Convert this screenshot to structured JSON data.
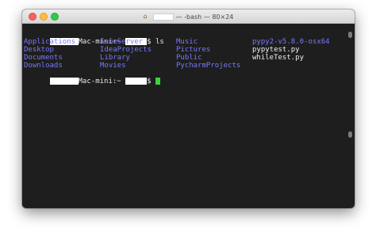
{
  "window": {
    "title_suffix": "— -bash — 80×24"
  },
  "prompt1": {
    "host_suffix": "Mac-mini:~",
    "user_suffix": "$",
    "command": "ls"
  },
  "listing": {
    "rows": [
      [
        {
          "name": "Applications",
          "kind": "dir"
        },
        {
          "name": "GameServer",
          "kind": "dir"
        },
        {
          "name": "Music",
          "kind": "dir"
        },
        {
          "name": "pypy2-v5.8.0-osx64",
          "kind": "dir"
        }
      ],
      [
        {
          "name": "Desktop",
          "kind": "dir"
        },
        {
          "name": "IdeaProjects",
          "kind": "dir"
        },
        {
          "name": "Pictures",
          "kind": "dir"
        },
        {
          "name": "pypytest.py",
          "kind": "file"
        }
      ],
      [
        {
          "name": "Documents",
          "kind": "dir"
        },
        {
          "name": "Library",
          "kind": "dir"
        },
        {
          "name": "Public",
          "kind": "dir"
        },
        {
          "name": "whileTest.py",
          "kind": "file"
        }
      ],
      [
        {
          "name": "Downloads",
          "kind": "dir"
        },
        {
          "name": "Movies",
          "kind": "dir"
        },
        {
          "name": "PycharmProjects",
          "kind": "dir"
        },
        null
      ]
    ]
  },
  "prompt2": {
    "host_suffix": "Mac-mini:~",
    "user_suffix": "$"
  },
  "colors": {
    "directory": "#7878ff",
    "file": "#f0f0f0",
    "cursor": "#3cd33c",
    "background": "#1e1e1e"
  }
}
